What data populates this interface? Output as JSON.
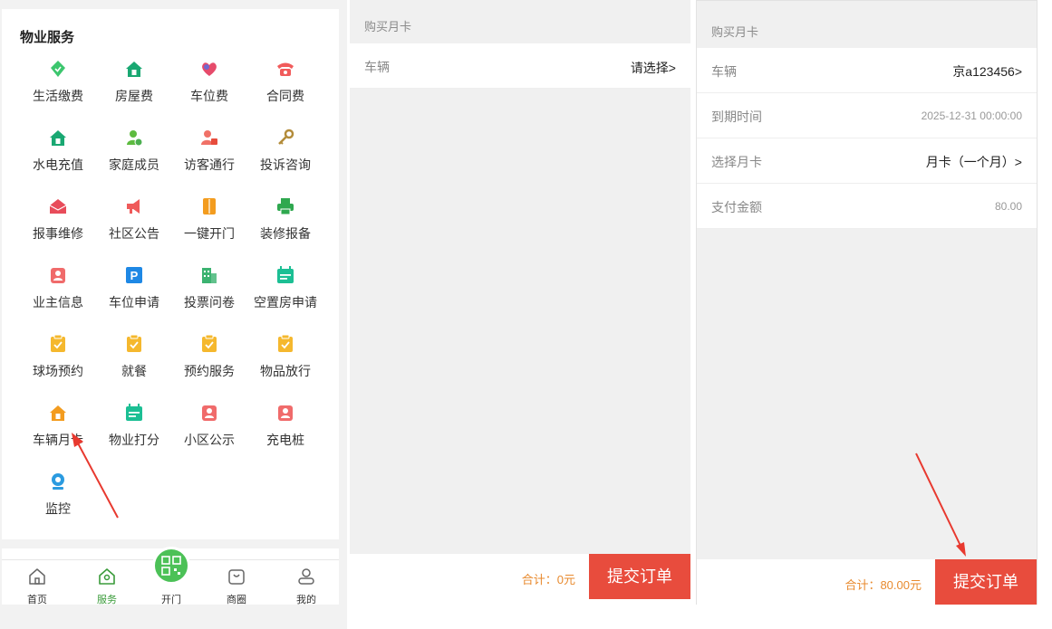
{
  "services": {
    "title": "物业服务",
    "items": [
      {
        "label": "生活缴费",
        "icon": "leaf-icon",
        "color": "#3cc66e"
      },
      {
        "label": "房屋费",
        "icon": "house-icon",
        "color": "#19a872"
      },
      {
        "label": "车位费",
        "icon": "heart-icon",
        "color": "#e64b6b"
      },
      {
        "label": "合同费",
        "icon": "telephone-icon",
        "color": "#f15b5b"
      },
      {
        "label": "水电充值",
        "icon": "house-icon",
        "color": "#19a872"
      },
      {
        "label": "家庭成员",
        "icon": "user-add-icon",
        "color": "#5dbb3f"
      },
      {
        "label": "访客通行",
        "icon": "user-lock-icon",
        "color": "#f07167"
      },
      {
        "label": "投诉咨询",
        "icon": "key-icon",
        "color": "#b38c3a"
      },
      {
        "label": "报事维修",
        "icon": "mail-house-icon",
        "color": "#e84c5a"
      },
      {
        "label": "社区公告",
        "icon": "megaphone-icon",
        "color": "#ef5a5a"
      },
      {
        "label": "一键开门",
        "icon": "door-icon",
        "color": "#f39c1f"
      },
      {
        "label": "装修报备",
        "icon": "printer-icon",
        "color": "#2fa84f"
      },
      {
        "label": "业主信息",
        "icon": "id-badge-icon",
        "color": "#f06b6b"
      },
      {
        "label": "车位申请",
        "icon": "parking-icon",
        "color": "#1e88e5"
      },
      {
        "label": "投票问卷",
        "icon": "building-icon",
        "color": "#3cb371"
      },
      {
        "label": "空置房申请",
        "icon": "calendar-icon",
        "color": "#1cbf94"
      },
      {
        "label": "球场预约",
        "icon": "clipboard-check-icon",
        "color": "#f5b82e"
      },
      {
        "label": "就餐",
        "icon": "clipboard-check-icon",
        "color": "#f5b82e"
      },
      {
        "label": "预约服务",
        "icon": "clipboard-check-icon",
        "color": "#f5b82e"
      },
      {
        "label": "物品放行",
        "icon": "clipboard-check-icon",
        "color": "#f5b82e"
      },
      {
        "label": "车辆月卡",
        "icon": "house-icon",
        "color": "#f39c1f"
      },
      {
        "label": "物业打分",
        "icon": "calendar-icon",
        "color": "#1cbf94"
      },
      {
        "label": "小区公示",
        "icon": "id-badge-icon",
        "color": "#f06b6b"
      },
      {
        "label": "充电桩",
        "icon": "id-badge-icon",
        "color": "#f06b6b"
      },
      {
        "label": "监控",
        "icon": "camera-icon",
        "color": "#2b9be0"
      }
    ]
  },
  "tabbar": {
    "items": [
      {
        "label": "首页",
        "icon": "home-icon"
      },
      {
        "label": "服务",
        "icon": "service-home-icon",
        "active": true
      },
      {
        "label": "开门",
        "icon": "qrcode-icon"
      },
      {
        "label": "商圈",
        "icon": "bag-icon"
      },
      {
        "label": "我的",
        "icon": "user-icon"
      }
    ],
    "active_color": "#3a9b3a",
    "open_button_color": "#4cc157"
  },
  "purchase_empty": {
    "title": "购买月卡",
    "vehicle_label": "车辆",
    "vehicle_value": "请选择>",
    "total": "合计：0元",
    "submit": "提交订单"
  },
  "purchase_filled": {
    "title": "购买月卡",
    "rows": [
      {
        "label": "车辆",
        "value": "京a123456>"
      },
      {
        "label": "到期时间",
        "value": "2025-12-31 00:00:00"
      },
      {
        "label": "选择月卡",
        "value": "月卡（一个月）>"
      },
      {
        "label": "支付金额",
        "value": "80.00"
      }
    ],
    "total": "合计：80.00元",
    "submit": "提交订单"
  },
  "colors": {
    "submit": "#e84c3d",
    "total": "#e88a2e",
    "annotation_arrow": "#e8392f"
  }
}
